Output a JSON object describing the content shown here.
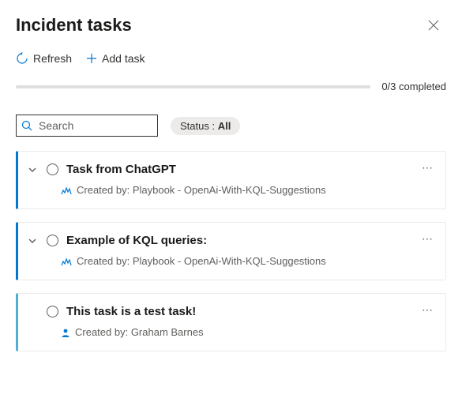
{
  "header": {
    "title": "Incident tasks"
  },
  "toolbar": {
    "refresh_label": "Refresh",
    "add_label": "Add task"
  },
  "progress": {
    "text": "0/3 completed"
  },
  "search": {
    "placeholder": "Search"
  },
  "status_filter": {
    "prefix": "Status : ",
    "value": "All"
  },
  "tasks": [
    {
      "title": "Task from ChatGPT",
      "created_by": "Created by: Playbook - OpenAi-With-KQL-Suggestions",
      "source": "playbook",
      "expandable": true,
      "accent": "#0078d4"
    },
    {
      "title": "Example of KQL queries:",
      "created_by": "Created by: Playbook - OpenAi-With-KQL-Suggestions",
      "source": "playbook",
      "expandable": true,
      "accent": "#0078d4"
    },
    {
      "title": "This task is a test task!",
      "created_by": "Created by: Graham Barnes",
      "source": "user",
      "expandable": false,
      "accent": "#50b0d4"
    }
  ]
}
